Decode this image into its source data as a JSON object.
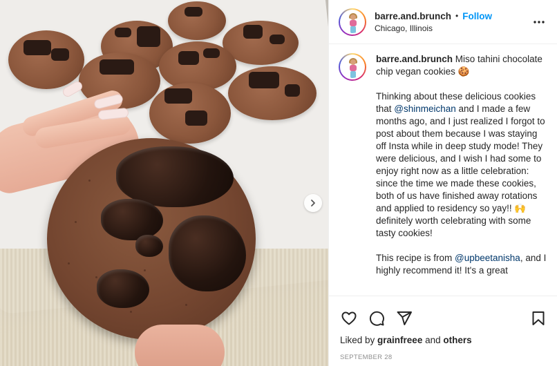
{
  "post": {
    "image_alt": "Hand holding a chocolate chip cookie over a plate of cookies"
  },
  "header": {
    "username": "barre.and.brunch",
    "dot": "•",
    "follow_label": "Follow",
    "location": "Chicago, Illinois",
    "more_icon": "more-horizontal-icon"
  },
  "caption": {
    "username": "barre.and.brunch",
    "title": "Miso tahini chocolate chip vegan cookies",
    "title_emoji": "🍪",
    "p1_a": "Thinking about these delicious cookies that ",
    "p1_mention": "@shinmeichan",
    "p1_b": " and I made a few months ago, and I just realized I forgot to post about them because I was staying off Insta while in deep study mode! They were delicious, and I wish I had some to enjoy right now as a little celebration: since the time we made these cookies, both of us have finished away rotations and applied to residency so yay!! ",
    "p1_emoji": "🙌",
    "p1_c": " definitely worth celebrating with some tasty cookies!",
    "p2_a": "This recipe is from ",
    "p2_mention": "@upbeetanisha",
    "p2_b": ", and I highly recommend it! It's a great"
  },
  "footer": {
    "liked_by_prefix": "Liked by ",
    "liked_by_user": "grainfreee",
    "liked_by_mid": " and ",
    "liked_by_others": "others",
    "date": "SEPTEMBER 28"
  },
  "colors": {
    "accent": "#0095f6",
    "mention": "#00376b",
    "muted": "#8e8e8e"
  }
}
